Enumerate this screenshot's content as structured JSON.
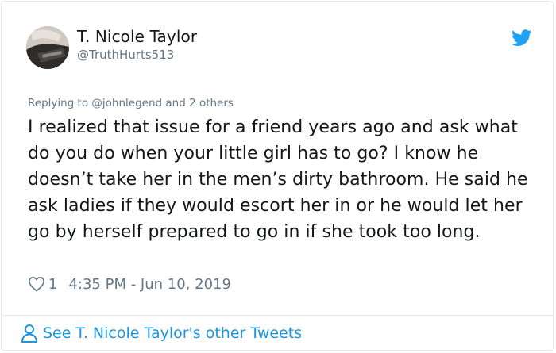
{
  "author": {
    "display_name": "T. Nicole Taylor",
    "handle": "@TruthHurts513",
    "avatar_icon": "avatar-photo"
  },
  "brand": {
    "icon": "twitter-bird-icon",
    "color": "#1da1f2"
  },
  "tweet": {
    "replying_to": "Replying to @johnlegend and 2 others",
    "text": "I realized that issue for a friend years ago and ask what do you do when your little girl has to go? I know he doesn’t take her in the men’s dirty bathroom. He said he ask ladies if they would escort her in or he would let her go by herself prepared to go in if she took too long.",
    "like_icon": "heart-icon",
    "like_count": "1",
    "timestamp": "4:35 PM - Jun 10, 2019"
  },
  "footer": {
    "icon": "person-icon",
    "link_text": "See T. Nicole Taylor's other Tweets",
    "link_color": "#1b95e0"
  },
  "colors": {
    "text_primary": "#14171a",
    "text_secondary": "#657786",
    "border": "#e1e8ed"
  }
}
